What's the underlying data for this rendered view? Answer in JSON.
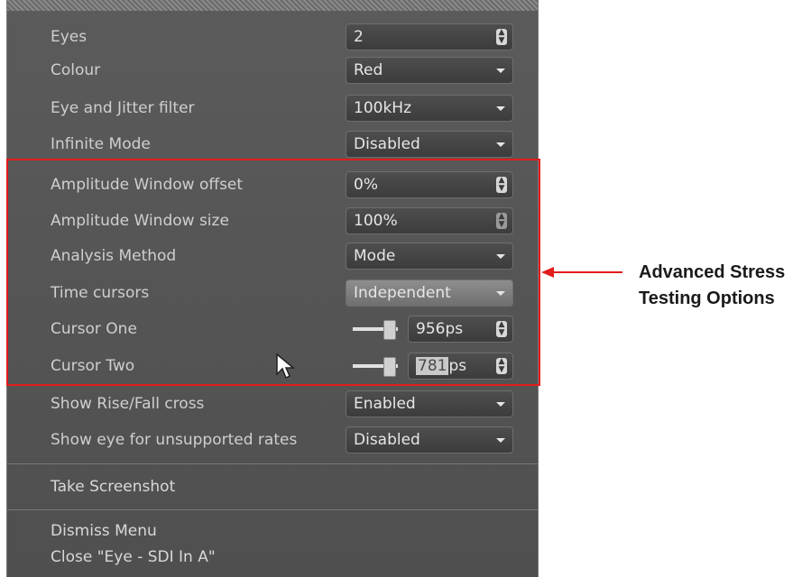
{
  "settings": [
    {
      "label": "Eyes",
      "value": "2",
      "kind": "spin"
    },
    {
      "label": "Colour",
      "value": "Red",
      "kind": "drop"
    },
    {
      "label": "Eye and Jitter filter",
      "value": "100kHz",
      "kind": "drop"
    },
    {
      "label": "Infinite Mode",
      "value": "Disabled",
      "kind": "drop"
    },
    {
      "label": "Amplitude Window offset",
      "value": "0%",
      "kind": "spin"
    },
    {
      "label": "Amplitude Window size",
      "value": "100%",
      "kind": "spin"
    },
    {
      "label": "Analysis Method",
      "value": "Mode",
      "kind": "drop"
    },
    {
      "label": "Time cursors",
      "value": "Independent",
      "kind": "drop"
    },
    {
      "label": "Cursor One",
      "value": "956ps",
      "kind": "slider"
    },
    {
      "label": "Cursor Two",
      "value_selected": "781",
      "value_rest": "ps",
      "kind": "slider"
    },
    {
      "label": "Show Rise/Fall cross",
      "value": "Enabled",
      "kind": "drop"
    },
    {
      "label": "Show eye for unsupported rates",
      "value": "Disabled",
      "kind": "drop"
    }
  ],
  "menu": {
    "take_screenshot": "Take Screenshot",
    "dismiss_menu": "Dismiss Menu",
    "close": "Close \"Eye - SDI In A\""
  },
  "callout": {
    "line1": "Advanced Stress",
    "line2": "Testing Options"
  },
  "colors": {
    "highlight_box": "#e21c1c",
    "panel": "#555555"
  }
}
